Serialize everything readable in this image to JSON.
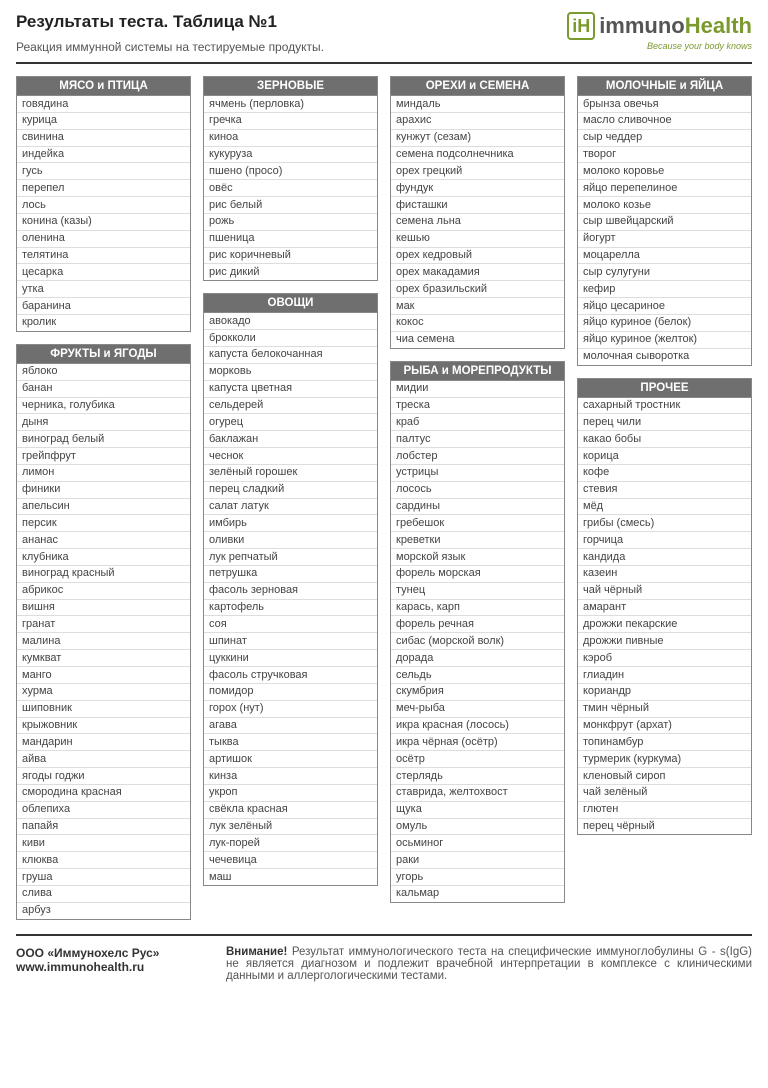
{
  "header": {
    "title": "Результаты теста. Таблица №1",
    "subtitle": "Реакция иммунной системы на тестируемые продукты.",
    "logo_text_1": "immuno",
    "logo_text_2": "Health",
    "logo_tagline": "Because your body knows"
  },
  "columns": [
    [
      {
        "title": "МЯСО и ПТИЦА",
        "items": [
          "говядина",
          "курица",
          "свинина",
          "индейка",
          "гусь",
          "перепел",
          "лось",
          "конина (казы)",
          "оленина",
          "телятина",
          "цесарка",
          "утка",
          "баранина",
          "кролик"
        ]
      },
      {
        "title": "ФРУКТЫ и ЯГОДЫ",
        "items": [
          "яблоко",
          "банан",
          "черника, голубика",
          "дыня",
          "виноград белый",
          "грейпфрут",
          "лимон",
          "финики",
          "апельсин",
          "персик",
          "ананас",
          "клубника",
          "виноград красный",
          "абрикос",
          "вишня",
          "гранат",
          "малина",
          "кумкват",
          "манго",
          "хурма",
          "шиповник",
          "крыжовник",
          "мандарин",
          "айва",
          "ягоды годжи",
          "смородина красная",
          "облепиха",
          "папайя",
          "киви",
          "клюква",
          "груша",
          "слива",
          "арбуз"
        ]
      }
    ],
    [
      {
        "title": "ЗЕРНОВЫЕ",
        "items": [
          "ячмень (перловка)",
          "гречка",
          "киноа",
          "кукуруза",
          "пшено (просо)",
          "овёс",
          "рис белый",
          "рожь",
          "пшеница",
          "рис коричневый",
          "рис дикий"
        ]
      },
      {
        "title": "ОВОЩИ",
        "items": [
          "авокадо",
          "брокколи",
          "капуста белокочанная",
          "морковь",
          "капуста цветная",
          "сельдерей",
          "огурец",
          "баклажан",
          "чеснок",
          "зелёный горошек",
          "перец сладкий",
          "салат латук",
          "имбирь",
          "оливки",
          "лук репчатый",
          "петрушка",
          "фасоль зерновая",
          "картофель",
          "соя",
          "шпинат",
          "цуккини",
          "фасоль стручковая",
          "помидор",
          "горох (нут)",
          "агава",
          "тыква",
          "артишок",
          "кинза",
          "укроп",
          "свёкла красная",
          "лук зелёный",
          "лук-порей",
          "чечевица",
          "маш"
        ]
      }
    ],
    [
      {
        "title": "ОРЕХИ и СЕМЕНА",
        "items": [
          "миндаль",
          "арахис",
          "кунжут (сезам)",
          "семена подсолнечника",
          "орех грецкий",
          "фундук",
          "фисташки",
          "семена льна",
          "кешью",
          "орех кедровый",
          "орех макадамия",
          "орех бразильский",
          "мак",
          "кокос",
          "чиа семена"
        ]
      },
      {
        "title": "РЫБА и МОРЕПРОДУКТЫ",
        "items": [
          "мидии",
          "треска",
          "краб",
          "палтус",
          "лобстер",
          "устрицы",
          "лосось",
          "сардины",
          "гребешок",
          "креветки",
          "морской язык",
          "форель морская",
          "тунец",
          "карась, карп",
          "форель речная",
          "сибас (морской волк)",
          "дорада",
          "сельдь",
          "скумбрия",
          "меч-рыба",
          "икра красная (лосось)",
          "икра чёрная (осётр)",
          "осётр",
          "стерлядь",
          "ставрида, желтохвост",
          "щука",
          "омуль",
          "осьминог",
          "раки",
          "угорь",
          "кальмар"
        ]
      }
    ],
    [
      {
        "title": "МОЛОЧНЫЕ и ЯЙЦА",
        "items": [
          "брынза овечья",
          "масло сливочное",
          "сыр чеддер",
          "творог",
          "молоко коровье",
          "яйцо перепелиное",
          "молоко козье",
          "сыр швейцарский",
          "йогурт",
          "моцарелла",
          "сыр сулугуни",
          "кефир",
          "яйцо цесариное",
          "яйцо куриное (белок)",
          "яйцо куриное (желток)",
          "молочная сыворотка"
        ]
      },
      {
        "title": "ПРОЧЕЕ",
        "items": [
          "сахарный тростник",
          "перец чили",
          "какао бобы",
          "корица",
          "кофе",
          "стевия",
          "мёд",
          "грибы (смесь)",
          "горчица",
          "кандида",
          "казеин",
          "чай чёрный",
          "амарант",
          "дрожжи пекарские",
          "дрожжи пивные",
          "кэроб",
          "глиадин",
          "кориандр",
          "тмин чёрный",
          "монкфрут (архат)",
          "топинамбур",
          "турмерик (куркума)",
          "кленовый сироп",
          "чай зелёный",
          "глютен",
          "перец чёрный"
        ]
      }
    ]
  ],
  "footer": {
    "company": "ООО «Иммунохелс Рус»",
    "url": "www.immunohealth.ru",
    "warning_label": "Внимание!",
    "warning_text": "Результат иммунологического теста на специфические иммуноглобулины G - s(IgG) не является диагнозом и подлежит врачебной интерпретации в комплексе с клиническими данными и аллергологическими тестами."
  }
}
